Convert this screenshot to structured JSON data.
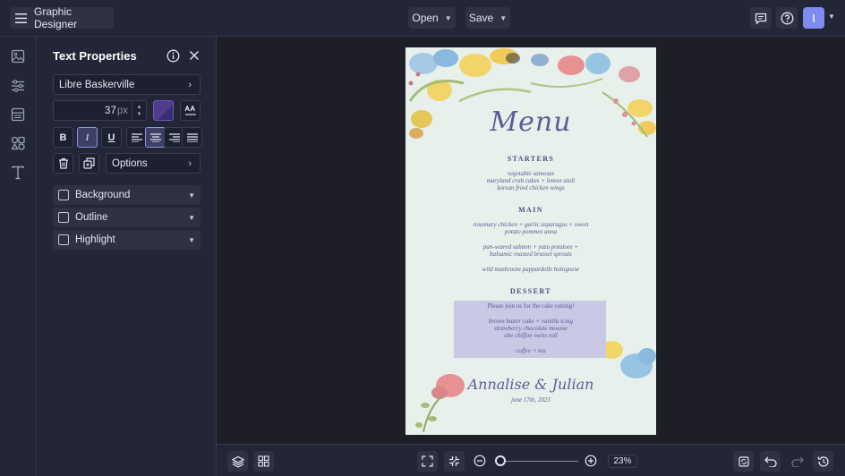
{
  "topbar": {
    "app_name": "Graphic Designer",
    "open_label": "Open",
    "save_label": "Save",
    "avatar_initial": "I"
  },
  "rail": {
    "icons": [
      "images-icon",
      "sliders-icon",
      "layout-icon",
      "elements-icon",
      "text-icon"
    ]
  },
  "panel": {
    "title": "Text Properties",
    "font_name": "Libre Baskerville",
    "font_size": "37",
    "font_size_unit": "px",
    "text_color": "#4f3c8c",
    "options_label": "Options",
    "accordions": [
      "Background",
      "Outline",
      "Highlight"
    ]
  },
  "document": {
    "title": "Menu",
    "starters_heading": "STARTERS",
    "starters_items": [
      "vegetable samosas",
      "maryland crab cakes + lemon aioli",
      "korean fried chicken wings"
    ],
    "main_heading": "MAIN",
    "main_items": [
      "rosemary chicken + garlic asparagus + sweet",
      "potato pommes anna",
      "pan-seared salmon + yuzu potatoes +",
      "balsamic roasted brussel sprouts",
      "wild mushroom pappardelle bolognese"
    ],
    "dessert_heading": "DESSERT",
    "dessert_note": "Please join us for the cake cutting!",
    "dessert_items": [
      "brown butter cake + vanilla icing",
      "strawberry chocolate mousse",
      "ube chiffon swiss roll",
      "coffee + tea"
    ],
    "names": "Annalise & Julian",
    "date": "june 17th, 2023"
  },
  "bottombar": {
    "zoom_value": "23",
    "zoom_unit": "%"
  },
  "colors": {
    "accent": "#7e8cf0",
    "doc_background": "#e7f0ea",
    "highlight": "#c9c9e6"
  }
}
